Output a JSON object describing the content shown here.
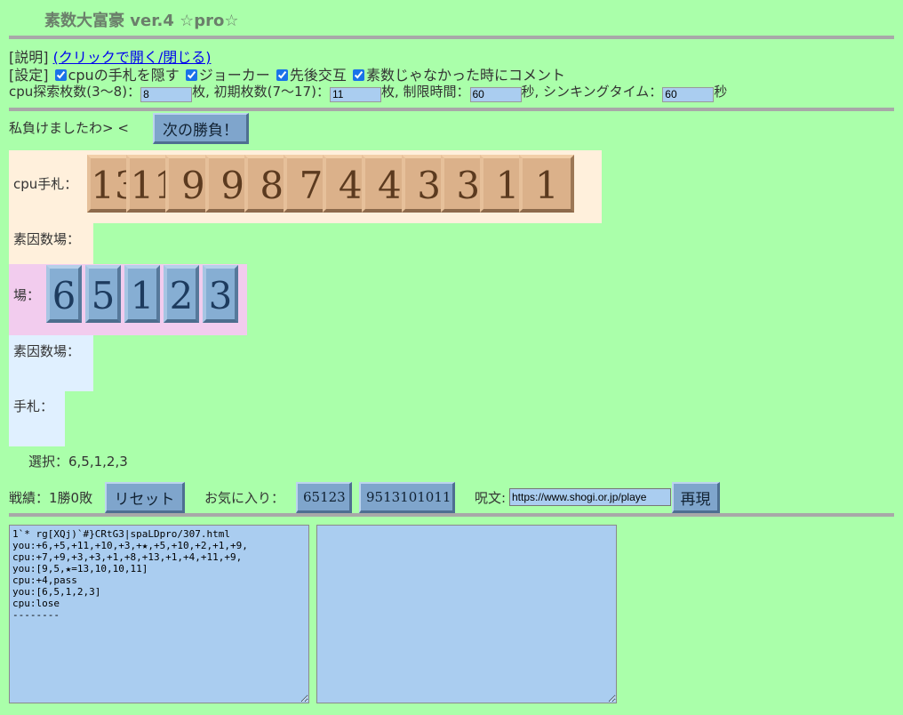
{
  "title": "素数大富豪 ver.4 ☆pro☆",
  "help": {
    "prefix": "[説明]",
    "link": "(クリックで開く/閉じる)"
  },
  "settings": {
    "prefix": "[設定]",
    "hide_cpu": {
      "label": "cpuの手札を隠す",
      "checked": true
    },
    "joker": {
      "label": "ジョーカー",
      "checked": true
    },
    "alternate": {
      "label": "先後交互",
      "checked": true
    },
    "comment": {
      "label": "素数じゃなかった時にコメント",
      "checked": true
    }
  },
  "params": {
    "cpu_search_label": "cpu探索枚数(3〜8)：",
    "cpu_search_value": "8",
    "unit1": "枚, 初期枚数(7〜17)：",
    "initial_value": "11",
    "unit2": "枚, 制限時間：",
    "time_value": "60",
    "unit3": "秒, シンキングタイム：",
    "thinking_value": "60",
    "unit4": "秒"
  },
  "status": {
    "message": "私負けましたわ> <",
    "next_button": "次の勝負！"
  },
  "cpu_hand": {
    "label": "cpu手札：",
    "cards": [
      "13",
      "11",
      "9",
      "9",
      "8",
      "7",
      "4",
      "4",
      "3",
      "3",
      "1",
      "1"
    ]
  },
  "cpu_factor": {
    "label": "素因数場："
  },
  "field": {
    "label": "場：",
    "cards": [
      "6",
      "5",
      "1",
      "2",
      "3"
    ]
  },
  "player_factor": {
    "label": "素因数場："
  },
  "player_hand": {
    "label": "手札："
  },
  "selection": {
    "text": "選択：6,5,1,2,3"
  },
  "record": {
    "label": "戦績：1勝0敗",
    "reset_button": "リセット"
  },
  "favorites": {
    "label": "お気に入り：",
    "items": [
      "65123",
      "9513101011"
    ]
  },
  "spell": {
    "label": "呪文:",
    "value": "https://www.shogi.or.jp/playe",
    "replay_button": "再現"
  },
  "log": "1`* rg[XQj)`#}CRtG3|spaLDpro/307.html\nyou:+6,+5,+11,+10,+3,+★,+5,+10,+2,+1,+9,\ncpu:+7,+9,+3,+3,+1,+8,+13,+1,+4,+11,+9,\nyou:[9,5,★=13,10,10,11]\ncpu:+4,pass\nyou:[6,5,1,2,3]\ncpu:lose\n--------",
  "colors": {
    "background": "#aaffaa",
    "card_cpu": "#dbb18a",
    "card_field": "#86aed3"
  }
}
